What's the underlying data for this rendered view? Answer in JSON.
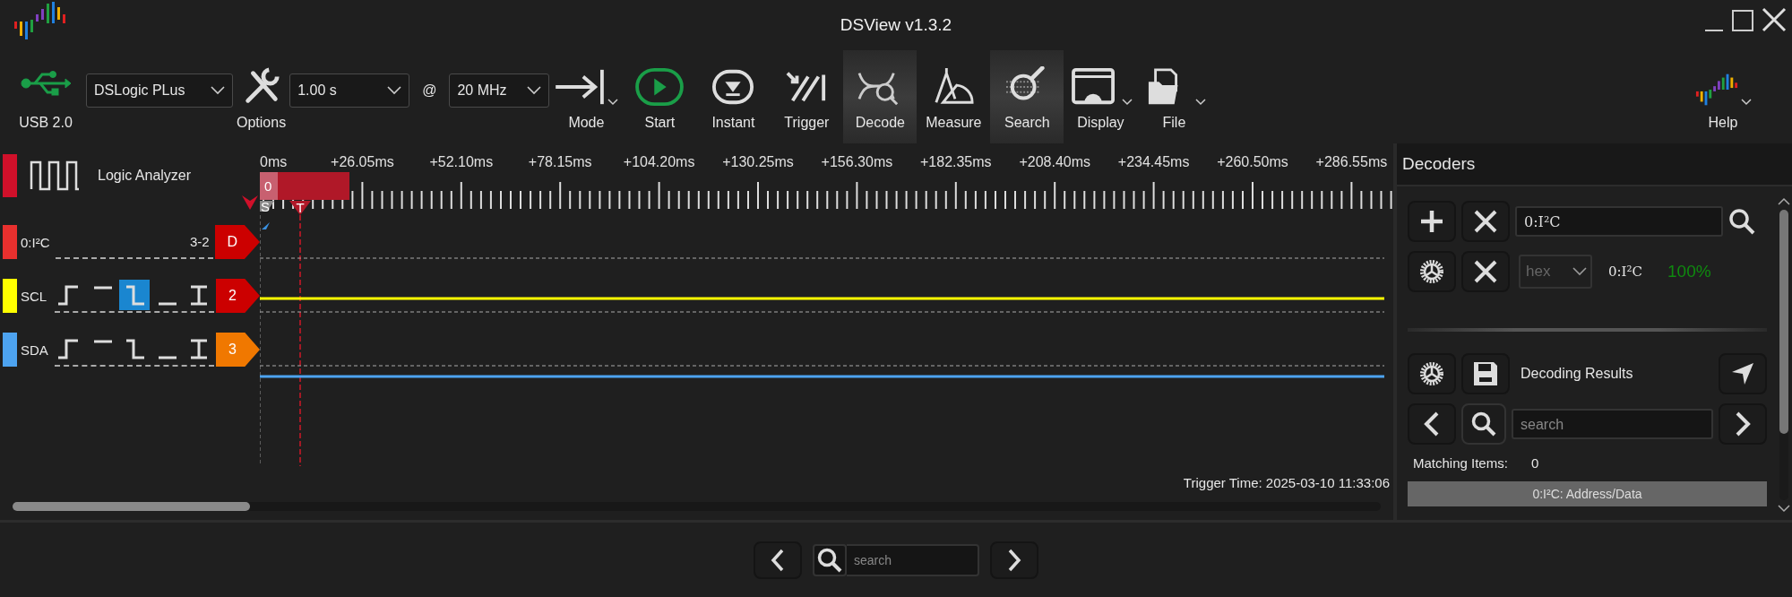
{
  "window": {
    "title": "DSView v1.3.2"
  },
  "toolbar": {
    "usb": {
      "label": "USB 2.0"
    },
    "device": {
      "value": "DSLogic PLus"
    },
    "options": {
      "label": "Options"
    },
    "duration": {
      "value": "1.00 s"
    },
    "at": "@",
    "rate": {
      "value": "20 MHz"
    },
    "buttons": [
      {
        "kind": "mode",
        "label": "Mode",
        "selected": false,
        "menu": true
      },
      {
        "kind": "start",
        "label": "Start",
        "selected": false,
        "menu": false
      },
      {
        "kind": "instant",
        "label": "Instant",
        "selected": false,
        "menu": false
      },
      {
        "kind": "trigger",
        "label": "Trigger",
        "selected": false,
        "menu": false
      },
      {
        "kind": "decode",
        "label": "Decode",
        "selected": true,
        "menu": false
      },
      {
        "kind": "measure",
        "label": "Measure",
        "selected": false,
        "menu": false
      },
      {
        "kind": "search",
        "label": "Search",
        "selected": true,
        "menu": false
      },
      {
        "kind": "display",
        "label": "Display",
        "selected": false,
        "menu": true
      },
      {
        "kind": "file",
        "label": "File",
        "selected": false,
        "menu": true
      }
    ],
    "help": {
      "label": "Help",
      "menu": true
    }
  },
  "header": {
    "title": "Logic Analyzer"
  },
  "ruler": {
    "labels": [
      "0ms",
      "+26.05ms",
      "+52.10ms",
      "+78.15ms",
      "+104.20ms",
      "+130.25ms",
      "+156.30ms",
      "+182.35ms",
      "+208.40ms",
      "+234.45ms",
      "+260.50ms",
      "+286.55ms"
    ],
    "markers": [
      {
        "kind": "cursor",
        "label": "0"
      },
      {
        "kind": "start",
        "label": "S"
      },
      {
        "kind": "trigger",
        "label": "T"
      }
    ]
  },
  "channels": [
    {
      "kind": "decoder",
      "name": "0:I²C",
      "color": "#e8302e",
      "range": "3-2",
      "badge": {
        "label": "D",
        "color": "#cc0000"
      }
    },
    {
      "kind": "logic",
      "name": "SCL",
      "color": "#ffff00",
      "high": true,
      "badge": {
        "label": "2",
        "color": "#cc0000"
      },
      "triggers": [
        {
          "kind": "rise",
          "selected": false
        },
        {
          "kind": "high",
          "selected": false
        },
        {
          "kind": "fall",
          "selected": true
        },
        {
          "kind": "low",
          "selected": false
        },
        {
          "kind": "edge",
          "selected": false
        }
      ]
    },
    {
      "kind": "logic",
      "name": "SDA",
      "color": "#4da3f0",
      "high": false,
      "badge": {
        "label": "3",
        "color": "#f07800"
      },
      "triggers": [
        {
          "kind": "rise",
          "selected": false
        },
        {
          "kind": "high",
          "selected": false
        },
        {
          "kind": "fall",
          "selected": false
        },
        {
          "kind": "low",
          "selected": false
        },
        {
          "kind": "edge",
          "selected": false
        }
      ]
    }
  ],
  "trigger_time": "Trigger Time: 2025-03-10 11:33:06",
  "decoders": {
    "title": "Decoders",
    "filter": {
      "value": "0:I²C"
    },
    "items": [
      {
        "format": {
          "value": "hex",
          "disabled": true
        },
        "name": "0:I²C",
        "progress": "100%",
        "complete": true
      }
    ],
    "results": {
      "title": "Decoding Results",
      "search": {
        "placeholder": "search"
      },
      "matching_label": "Matching Items:",
      "matching_count": "0",
      "columns": [
        "0:I²C: Address/Data"
      ]
    }
  },
  "bottom_search": {
    "placeholder": "search"
  }
}
